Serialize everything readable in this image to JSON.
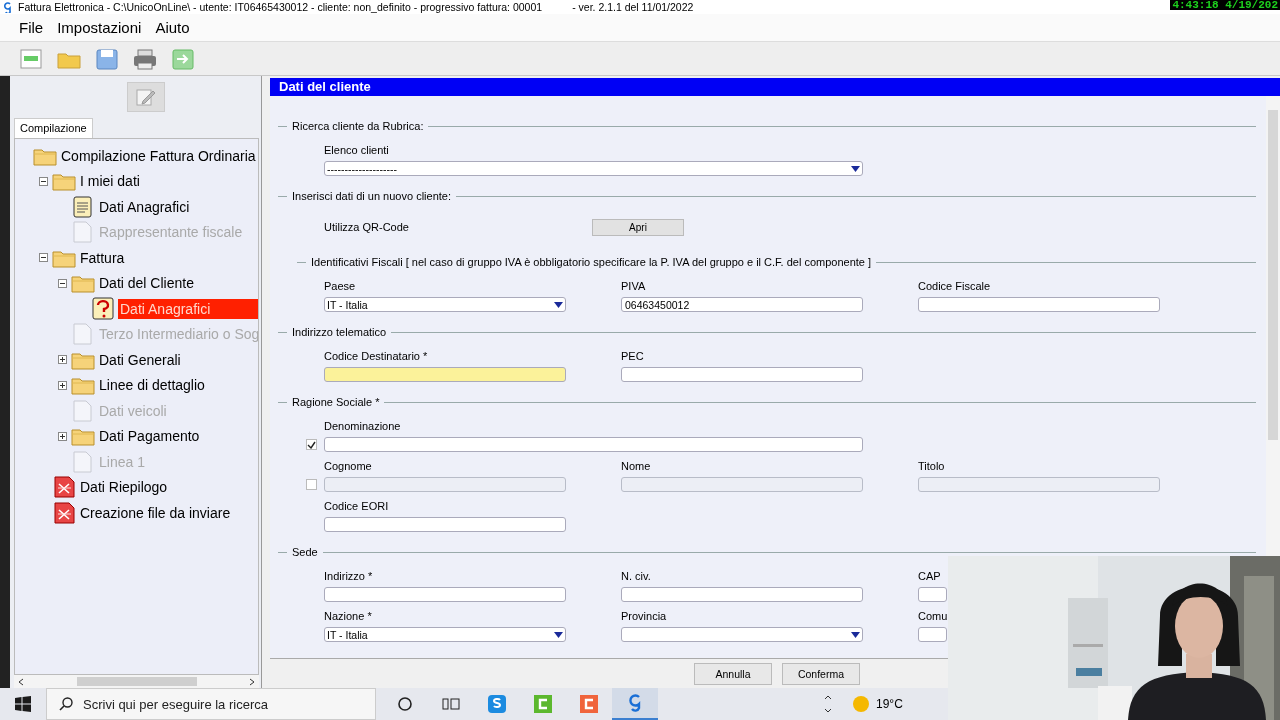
{
  "window": {
    "title": "Fattura Elettronica - C:\\UnicoOnLine\\ - utente: IT06465430012 - cliente: non_definito - progressivo fattura: 00001",
    "version": "- ver. 2.1.1 del 11/01/2022"
  },
  "clock": "4:43:18 4/19/202",
  "menu": [
    "File",
    "Impostazioni",
    "Aiuto"
  ],
  "toolbar": [
    {
      "kind": "new",
      "disabled": false
    },
    {
      "kind": "open",
      "disabled": false
    },
    {
      "kind": "save",
      "disabled": false
    },
    {
      "kind": "print",
      "disabled": false
    },
    {
      "kind": "exit",
      "disabled": false
    }
  ],
  "sidebar": {
    "tabs": [
      {
        "label": "Compilazione",
        "selected": true
      }
    ],
    "tree": [
      {
        "label": "Compilazione Fattura Ordinaria",
        "kind": "folder",
        "disabled": false,
        "selected": false,
        "children": [
          {
            "label": "I miei dati",
            "kind": "folder",
            "expanded": true,
            "disabled": false,
            "selected": false,
            "children": [
              {
                "label": "Dati Anagrafici",
                "kind": "document",
                "disabled": false,
                "selected": false
              },
              {
                "label": "Rappresentante fiscale",
                "kind": "blank",
                "disabled": true,
                "selected": false
              }
            ]
          },
          {
            "label": "Fattura",
            "kind": "folder",
            "expanded": true,
            "disabled": false,
            "selected": false,
            "children": [
              {
                "label": "Dati del Cliente",
                "kind": "folder",
                "expanded": true,
                "disabled": false,
                "selected": false,
                "children": [
                  {
                    "label": "Dati Anagrafici",
                    "kind": "question",
                    "disabled": false,
                    "selected": true
                  }
                ]
              },
              {
                "label": "Terzo Intermediario o Sog",
                "kind": "blank",
                "disabled": true,
                "selected": false
              },
              {
                "label": "Dati Generali",
                "kind": "folder",
                "expanded": false,
                "disabled": false,
                "selected": false
              },
              {
                "label": "Linee di dettaglio",
                "kind": "folder",
                "expanded": false,
                "disabled": false,
                "selected": false
              },
              {
                "label": "Dati veicoli",
                "kind": "blank",
                "disabled": true,
                "selected": false
              },
              {
                "label": "Dati Pagamento",
                "kind": "folder",
                "expanded": false,
                "disabled": false,
                "selected": false
              },
              {
                "label": "Linea 1",
                "kind": "blank",
                "disabled": true,
                "selected": false
              }
            ]
          },
          {
            "label": "Dati Riepilogo",
            "kind": "error",
            "disabled": false,
            "selected": false
          },
          {
            "label": "Creazione file da inviare",
            "kind": "error",
            "disabled": false,
            "selected": false
          }
        ]
      }
    ]
  },
  "panel": {
    "title": "Dati del cliente",
    "sections": [
      {
        "title": "Ricerca cliente da Rubrica:",
        "rows": [
          {
            "kind": "fields",
            "fields": [
              {
                "label": "Elenco clienti",
                "kind": "select",
                "value": "--------------------",
                "wide": true,
                "disabled": false,
                "highlighted": false
              }
            ]
          }
        ]
      },
      {
        "title": "Inserisci dati di un nuovo cliente:",
        "rows": [
          {
            "kind": "action",
            "label": "Utilizza QR-Code",
            "button": "Apri"
          }
        ],
        "subsections": [
          {
            "title": "Identificativi Fiscali [ nel caso di gruppo IVA è obbligatorio specificare la P. IVA del gruppo e il C.F. del componente ]",
            "rows": [
              {
                "kind": "fields",
                "fields": [
                  {
                    "label": "Paese",
                    "kind": "select",
                    "value": "IT - Italia",
                    "wide": false,
                    "disabled": false,
                    "highlighted": false
                  },
                  {
                    "label": "PIVA",
                    "kind": "text",
                    "value": "06463450012",
                    "wide": false,
                    "disabled": false,
                    "highlighted": false
                  },
                  {
                    "label": "Codice Fiscale",
                    "kind": "text",
                    "wide": false,
                    "disabled": false,
                    "highlighted": false
                  }
                ]
              }
            ]
          }
        ]
      },
      {
        "title": "Indirizzo telematico",
        "rows": [
          {
            "kind": "fields",
            "fields": [
              {
                "label": "Codice Destinatario *",
                "kind": "text",
                "wide": false,
                "disabled": false,
                "highlighted": true
              },
              {
                "label": "PEC",
                "kind": "text",
                "wide": false,
                "disabled": false,
                "highlighted": false
              }
            ]
          }
        ]
      },
      {
        "title": "Ragione Sociale *",
        "rows": [
          {
            "kind": "fields",
            "checked": true,
            "fields": [
              {
                "label": "Denominazione",
                "kind": "text",
                "wide": true,
                "disabled": false,
                "highlighted": false
              }
            ]
          },
          {
            "kind": "fields",
            "checked": false,
            "fields": [
              {
                "label": "Cognome",
                "kind": "text",
                "wide": false,
                "disabled": true,
                "highlighted": false
              },
              {
                "label": "Nome",
                "kind": "text",
                "wide": false,
                "disabled": true,
                "highlighted": false
              },
              {
                "label": "Titolo",
                "kind": "text",
                "wide": false,
                "disabled": true,
                "highlighted": false
              }
            ]
          },
          {
            "kind": "fields",
            "fields": [
              {
                "label": "Codice EORI",
                "kind": "text",
                "wide": false,
                "disabled": false,
                "highlighted": false
              }
            ]
          }
        ]
      },
      {
        "title": "Sede",
        "rows": [
          {
            "kind": "fields",
            "fields": [
              {
                "label": "Indirizzo *",
                "kind": "text",
                "wide": false,
                "disabled": false,
                "highlighted": false
              },
              {
                "label": "N. civ.",
                "kind": "text",
                "wide": false,
                "disabled": false,
                "highlighted": false
              },
              {
                "label": "CAP",
                "kind": "text",
                "wide": false,
                "disabled": false,
                "highlighted": false
              }
            ]
          },
          {
            "kind": "fields",
            "fields": [
              {
                "label": "Nazione *",
                "kind": "select",
                "value": "IT - Italia",
                "wide": false,
                "disabled": false,
                "highlighted": false
              },
              {
                "label": "Provincia",
                "kind": "select",
                "wide": false,
                "disabled": false,
                "highlighted": false
              },
              {
                "label": "Comu",
                "kind": "text",
                "wide": false,
                "disabled": false,
                "highlighted": false
              }
            ]
          }
        ]
      }
    ],
    "buttons": [
      "Annulla",
      "Conferma"
    ]
  },
  "webcam": {
    "kind": "picture"
  },
  "taskbar": {
    "search_placeholder": "Scrivi qui per eseguire la ricerca",
    "apps": [
      {
        "kind": "s",
        "selected": false
      },
      {
        "kind": "cgreen",
        "selected": false
      },
      {
        "kind": "corange",
        "selected": false
      },
      {
        "kind": "g",
        "selected": true
      }
    ],
    "weather": "19°C"
  }
}
